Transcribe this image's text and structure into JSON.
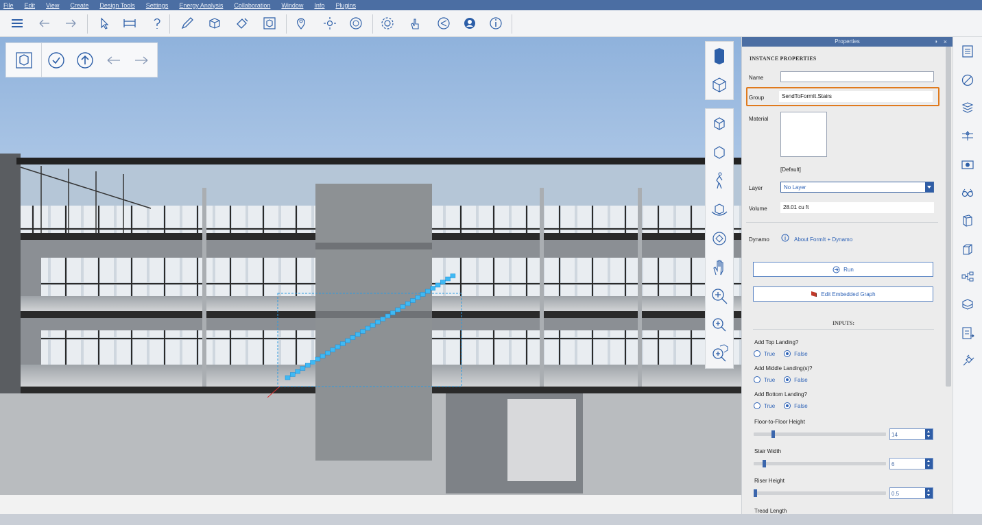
{
  "menu": [
    "File",
    "Edit",
    "View",
    "Create",
    "Design Tools",
    "Settings",
    "Energy Analysis",
    "Collaboration",
    "Window",
    "Info",
    "Plugins"
  ],
  "properties_panel": {
    "title": "Properties",
    "section_title": "INSTANCE PROPERTIES",
    "name_label": "Name",
    "name_value": "",
    "group_label": "Group",
    "group_value": "SendToFormIt.Stairs",
    "material_label": "Material",
    "material_value": "[Default]",
    "layer_label": "Layer",
    "layer_value": "No Layer",
    "volume_label": "Volume",
    "volume_value": "28.01 cu ft",
    "dynamo_label": "Dynamo",
    "dynamo_link": "About FormIt + Dynamo",
    "run_button": "Run",
    "edit_graph_button": "Edit Embedded Graph",
    "inputs_title": "INPUTS:",
    "inputs": [
      {
        "label": "Add Top Landing?",
        "true_label": "True",
        "false_label": "False",
        "selected": "False"
      },
      {
        "label": "Add Middle Landing(s)?",
        "true_label": "True",
        "false_label": "False",
        "selected": "False"
      },
      {
        "label": "Add Bottom Landing?",
        "true_label": "True",
        "false_label": "False",
        "selected": "False"
      }
    ],
    "sliders": [
      {
        "label": "Floor-to-Floor Height",
        "value": "14",
        "level": 0.14
      },
      {
        "label": "Stair Width",
        "value": "6",
        "level": 0.07
      },
      {
        "label": "Riser Height",
        "value": "0.5",
        "level": 0.0
      }
    ],
    "truncated_label": "Tread Length"
  },
  "colors": {
    "accent": "#2d62b6",
    "highlight": "#e07a1d",
    "menubar": "#4b6ea3",
    "stairs": "#36b3f0"
  }
}
